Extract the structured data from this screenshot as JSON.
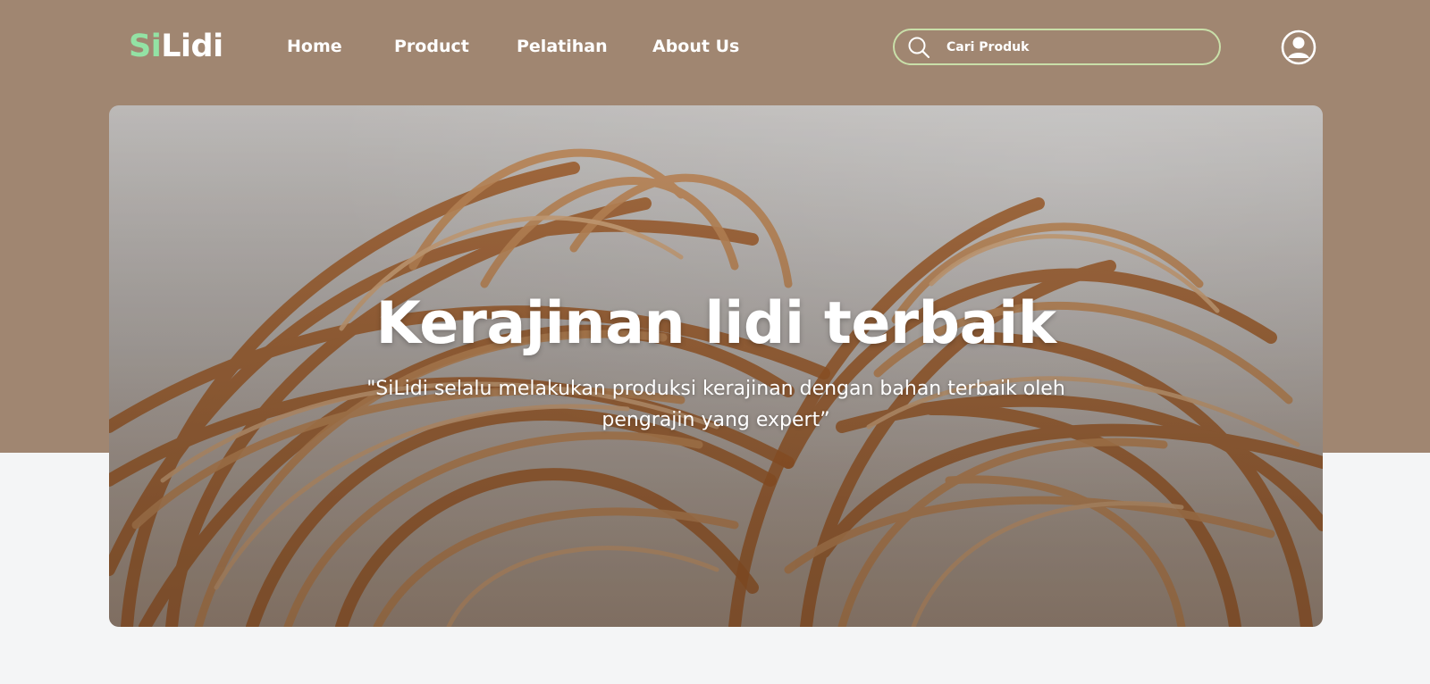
{
  "brand": {
    "prefix": "Si",
    "suffix": "Lidi"
  },
  "nav": {
    "items": [
      {
        "label": "Home"
      },
      {
        "label": "Product"
      },
      {
        "label": "Pelatihan"
      },
      {
        "label": "About Us"
      }
    ]
  },
  "search": {
    "placeholder": "Cari Produk",
    "value": "",
    "icon": "search-icon"
  },
  "account": {
    "icon": "user-circle-icon"
  },
  "hero": {
    "title": "Kerajinan lidi terbaik",
    "subtitle": "\"SiLidi selalu melakukan produksi kerajinan dengan bahan terbaik oleh pengrajin yang expert”"
  },
  "colors": {
    "header_bg": "#a08671",
    "page_bg": "#f4f5f6",
    "brand_accent": "#93e2a4",
    "search_border": "#c9dfa9",
    "text_light": "#ffffff"
  }
}
